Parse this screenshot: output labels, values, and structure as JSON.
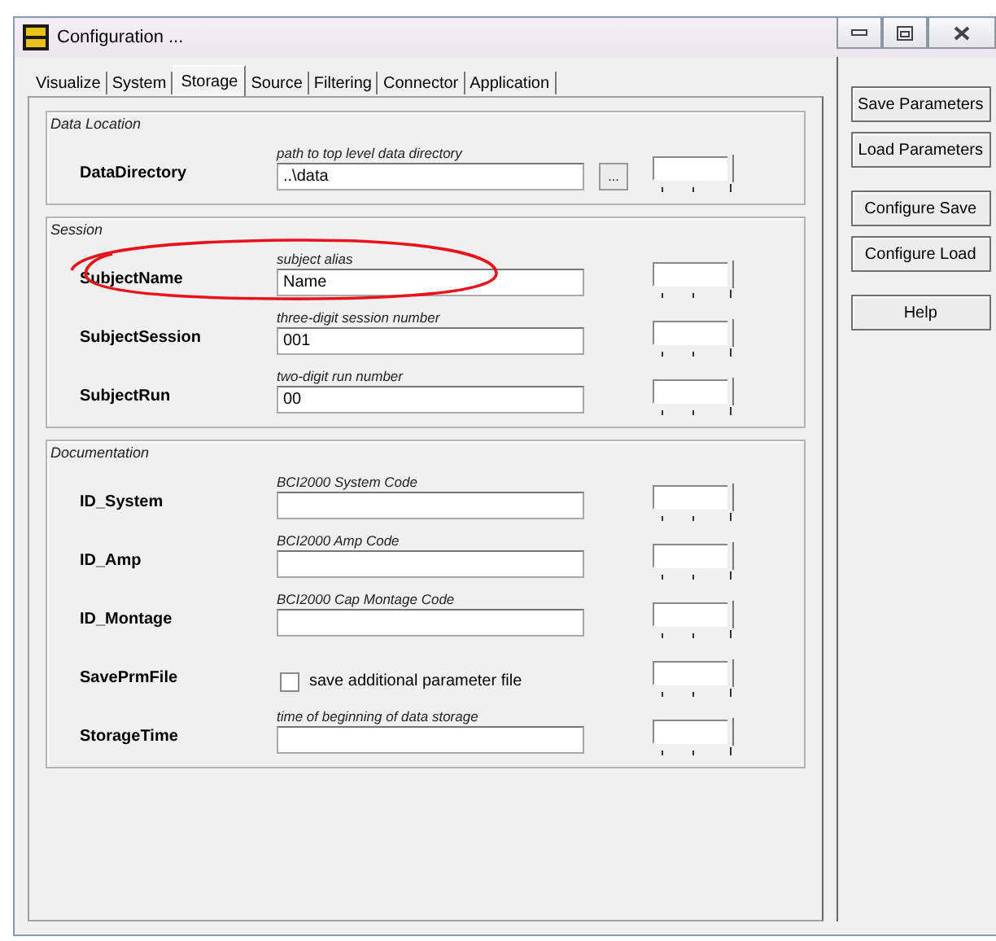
{
  "window": {
    "title": "Configuration ..."
  },
  "tabs": [
    {
      "label": "Visualize",
      "selected": false
    },
    {
      "label": "System",
      "selected": false
    },
    {
      "label": "Storage",
      "selected": true
    },
    {
      "label": "Source",
      "selected": false
    },
    {
      "label": "Filtering",
      "selected": false
    },
    {
      "label": "Connector",
      "selected": false
    },
    {
      "label": "Application",
      "selected": false
    }
  ],
  "groups": [
    {
      "title": "Data Location",
      "params": [
        {
          "kind": "text",
          "name": "DataDirectory",
          "hint": "path to top level data directory",
          "value": "..\\data",
          "browse": "...",
          "level": 1
        }
      ]
    },
    {
      "title": "Session",
      "params": [
        {
          "kind": "text",
          "name": "SubjectName",
          "hint": "subject alias",
          "value": "Name",
          "level": 1,
          "circled": true
        },
        {
          "kind": "text",
          "name": "SubjectSession",
          "hint": "three-digit session number",
          "value": "001",
          "level": 1
        },
        {
          "kind": "text",
          "name": "SubjectRun",
          "hint": "two-digit run number",
          "value": "00",
          "level": 1
        }
      ]
    },
    {
      "title": "Documentation",
      "params": [
        {
          "kind": "text",
          "name": "ID_System",
          "hint": "BCI2000 System Code",
          "level": 1
        },
        {
          "kind": "text",
          "name": "ID_Amp",
          "hint": "BCI2000 Amp Code",
          "level": 1
        },
        {
          "kind": "text",
          "name": "ID_Montage",
          "hint": "BCI2000 Cap Montage Code",
          "level": 1
        },
        {
          "kind": "checkbox",
          "name": "SavePrmFile",
          "label": "save additional parameter file",
          "checked": false,
          "level": 1
        },
        {
          "kind": "text",
          "name": "StorageTime",
          "hint": "time of beginning of data storage",
          "level": 1
        }
      ]
    }
  ],
  "button_groups": [
    [
      "Save Parameters",
      "Load Parameters"
    ],
    [
      "Configure Save",
      "Configure Load"
    ],
    [
      "Help"
    ]
  ]
}
